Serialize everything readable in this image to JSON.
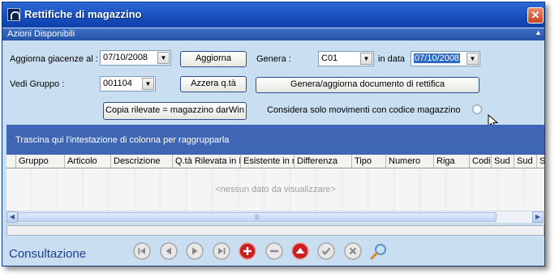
{
  "window": {
    "title": "Rettifiche di magazzino",
    "close_glyph": "✕"
  },
  "actions_bar": {
    "label": "Azioni Disponibili",
    "collapse_glyph": "▲"
  },
  "form": {
    "aggiorna_label": "Aggiorna giacenze al :",
    "aggiorna_date": "07/10/2008",
    "aggiorna_button": "Aggiorna",
    "genera_label": "Genera :",
    "genera_value": "C01",
    "in_data_label": "in data",
    "in_data_value": "07/10/2008",
    "vedi_gruppo_label": "Vedi Gruppo :",
    "vedi_gruppo_value": "001104",
    "azzera_button": "Azzera q.tà",
    "genera_doc_button": "Genera/aggiorna documento di rettifica",
    "copia_button": "Copia rilevate = magazzino darWin",
    "considera_label": "Considera solo movimenti con codice magazzino"
  },
  "grid": {
    "group_hint": "Trascina qui l'intestazione di colonna per raggrupparla",
    "columns": [
      "Gruppo",
      "Articolo",
      "Descrizione",
      "Q.tà Rilevata in Ib",
      "Esistente in m",
      "Differenza",
      "Tipo",
      "Numero",
      "Riga",
      "Codi",
      "Sud",
      "Sud",
      "S"
    ],
    "rows": [],
    "empty_text": "<nessun dato da visualizzare>"
  },
  "footer": {
    "title": "Consultazione",
    "nav_buttons": [
      "first-icon",
      "previous-icon",
      "next-icon",
      "last-icon",
      "add-icon",
      "remove-icon",
      "up-icon",
      "confirm-icon",
      "cancel-icon",
      "search-icon"
    ]
  },
  "colors": {
    "title_bar": "#1a54c3",
    "panel": "#c9dff1",
    "grid_bar": "#3f66b4",
    "accent_red": "#cc1f1f"
  }
}
